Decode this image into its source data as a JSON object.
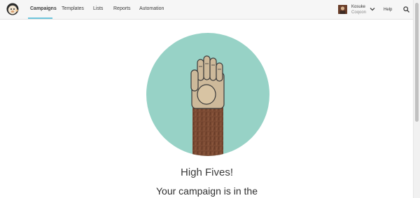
{
  "nav": {
    "items": [
      {
        "label": "Campaigns"
      },
      {
        "label": "Templates"
      },
      {
        "label": "Lists"
      },
      {
        "label": "Reports"
      },
      {
        "label": "Automation"
      }
    ],
    "active_index": 0
  },
  "user": {
    "name": "Kosuke",
    "org": "Coqoon"
  },
  "help_label": "Help",
  "icons": {
    "logo": "mailchimp-logo-icon",
    "chevron": "chevron-down-icon",
    "search": "search-icon",
    "hero": "high-five-hand-illustration"
  },
  "colors": {
    "circle": "#97d2c6",
    "arm": "#7b4a33",
    "hand": "#cdb99a",
    "accent_underline": "#6dc5dc"
  },
  "main": {
    "headline": "High Fives!",
    "subline": "Your campaign is in the"
  }
}
